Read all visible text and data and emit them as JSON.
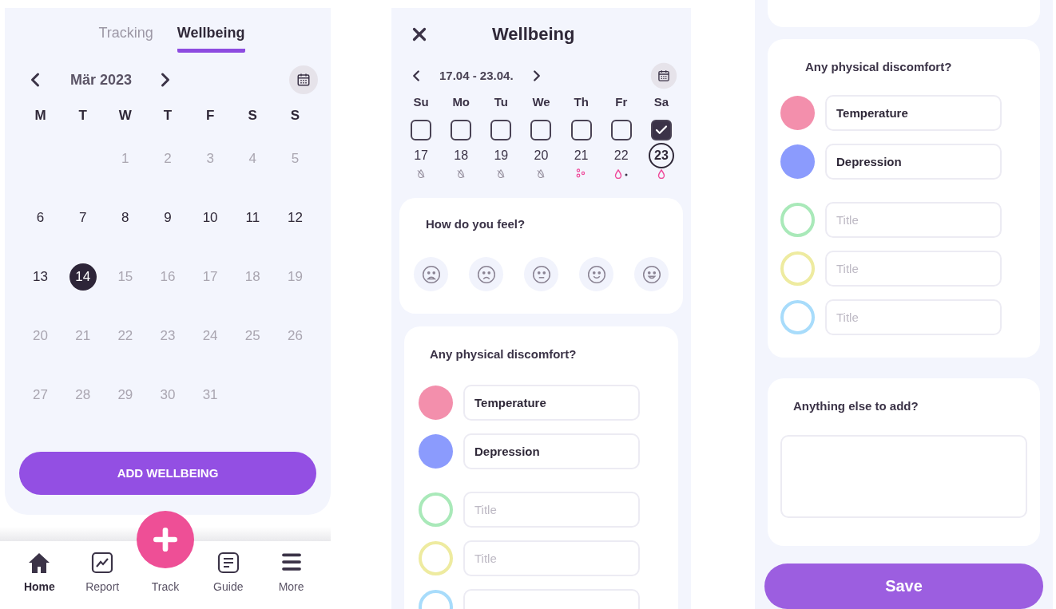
{
  "calendar_screen": {
    "tabs": [
      {
        "label": "Tracking",
        "selected": false
      },
      {
        "label": "Wellbeing",
        "selected": true
      }
    ],
    "month": "Mär 2023",
    "weekdays": [
      "M",
      "T",
      "W",
      "T",
      "F",
      "S",
      "S"
    ],
    "days": [
      {
        "kind": "blank"
      },
      {
        "kind": "blank"
      },
      {
        "kind": "day",
        "label": "1",
        "muted": true,
        "selected": false
      },
      {
        "kind": "day",
        "label": "2",
        "muted": true,
        "selected": false
      },
      {
        "kind": "day",
        "label": "3",
        "muted": true,
        "selected": false
      },
      {
        "kind": "day",
        "label": "4",
        "muted": true,
        "selected": false
      },
      {
        "kind": "day",
        "label": "5",
        "muted": true,
        "selected": false
      },
      {
        "kind": "day",
        "label": "6",
        "muted": false,
        "selected": false
      },
      {
        "kind": "day",
        "label": "7",
        "muted": false,
        "selected": false
      },
      {
        "kind": "day",
        "label": "8",
        "muted": false,
        "selected": false
      },
      {
        "kind": "day",
        "label": "9",
        "muted": false,
        "selected": false
      },
      {
        "kind": "day",
        "label": "10",
        "muted": false,
        "selected": false
      },
      {
        "kind": "day",
        "label": "11",
        "muted": false,
        "selected": false
      },
      {
        "kind": "day",
        "label": "12",
        "muted": false,
        "selected": false
      },
      {
        "kind": "day",
        "label": "13",
        "muted": false,
        "selected": false
      },
      {
        "kind": "day",
        "label": "14",
        "muted": false,
        "selected": true
      },
      {
        "kind": "day",
        "label": "15",
        "muted": true,
        "selected": false
      },
      {
        "kind": "day",
        "label": "16",
        "muted": true,
        "selected": false
      },
      {
        "kind": "day",
        "label": "17",
        "muted": true,
        "selected": false
      },
      {
        "kind": "day",
        "label": "18",
        "muted": true,
        "selected": false
      },
      {
        "kind": "day",
        "label": "19",
        "muted": true,
        "selected": false
      },
      {
        "kind": "day",
        "label": "20",
        "muted": true,
        "selected": false
      },
      {
        "kind": "day",
        "label": "21",
        "muted": true,
        "selected": false
      },
      {
        "kind": "day",
        "label": "22",
        "muted": true,
        "selected": false
      },
      {
        "kind": "day",
        "label": "23",
        "muted": true,
        "selected": false
      },
      {
        "kind": "day",
        "label": "24",
        "muted": true,
        "selected": false
      },
      {
        "kind": "day",
        "label": "25",
        "muted": true,
        "selected": false
      },
      {
        "kind": "day",
        "label": "26",
        "muted": true,
        "selected": false
      },
      {
        "kind": "day",
        "label": "27",
        "muted": true,
        "selected": false
      },
      {
        "kind": "day",
        "label": "28",
        "muted": true,
        "selected": false
      },
      {
        "kind": "day",
        "label": "29",
        "muted": true,
        "selected": false
      },
      {
        "kind": "day",
        "label": "30",
        "muted": true,
        "selected": false
      },
      {
        "kind": "day",
        "label": "31",
        "muted": true,
        "selected": false
      }
    ],
    "add_button": "ADD WELLBEING",
    "nav": [
      {
        "kind": "home",
        "label": "Home",
        "selected": true
      },
      {
        "kind": "report",
        "label": "Report",
        "selected": false
      },
      {
        "kind": "fab",
        "label": "Track",
        "selected": false
      },
      {
        "kind": "guide",
        "label": "Guide",
        "selected": false
      },
      {
        "kind": "more",
        "label": "More",
        "selected": false
      }
    ]
  },
  "wellbeing_screen": {
    "title": "Wellbeing",
    "range": "17.04 - 23.04.",
    "week": [
      {
        "name": "Su",
        "date": "17",
        "checked": false,
        "today": false,
        "marker": {
          "kind": "none"
        }
      },
      {
        "name": "Mo",
        "date": "18",
        "checked": false,
        "today": false,
        "marker": {
          "kind": "none"
        }
      },
      {
        "name": "Tu",
        "date": "19",
        "checked": false,
        "today": false,
        "marker": {
          "kind": "none"
        }
      },
      {
        "name": "We",
        "date": "20",
        "checked": false,
        "today": false,
        "marker": {
          "kind": "none"
        }
      },
      {
        "name": "Th",
        "date": "21",
        "checked": false,
        "today": false,
        "marker": {
          "kind": "spots"
        }
      },
      {
        "name": "Fr",
        "date": "22",
        "checked": false,
        "today": false,
        "marker": {
          "kind": "drop-dot"
        }
      },
      {
        "name": "Sa",
        "date": "23",
        "checked": true,
        "today": true,
        "marker": {
          "kind": "drop"
        }
      }
    ],
    "feel": {
      "question": "How do you feel?",
      "moods": [
        {
          "kind": "awful",
          "selected": false
        },
        {
          "kind": "sad",
          "selected": false
        },
        {
          "kind": "neutral",
          "selected": false
        },
        {
          "kind": "happy",
          "selected": false
        },
        {
          "kind": "very-happy",
          "selected": false
        }
      ]
    },
    "discomfort": {
      "question": "Any physical discomfort?",
      "items": [
        {
          "color": "#f38fac",
          "filled": true,
          "value": "Temperature"
        },
        {
          "color": "#8b9bfd",
          "filled": true,
          "value": "Depression"
        },
        {
          "color": "#a9e9b9",
          "filled": false,
          "placeholder": "Title"
        },
        {
          "color": "#eeeba0",
          "filled": false,
          "placeholder": "Title"
        },
        {
          "color": "#a8dcfb",
          "filled": false
        }
      ]
    }
  },
  "wellbeing_screen_scrolled": {
    "discomfort": {
      "question": "Any physical discomfort?",
      "items": [
        {
          "color": "#f38fac",
          "filled": true,
          "value": "Temperature"
        },
        {
          "color": "#8b9bfd",
          "filled": true,
          "value": "Depression"
        },
        {
          "color": "#a9e9b9",
          "filled": false,
          "placeholder": "Title"
        },
        {
          "color": "#eeeba0",
          "filled": false,
          "placeholder": "Title"
        },
        {
          "color": "#a8dcfb",
          "filled": false,
          "placeholder": "Title"
        }
      ]
    },
    "notes": {
      "question": "Anything else to add?"
    },
    "save_button": "Save"
  }
}
